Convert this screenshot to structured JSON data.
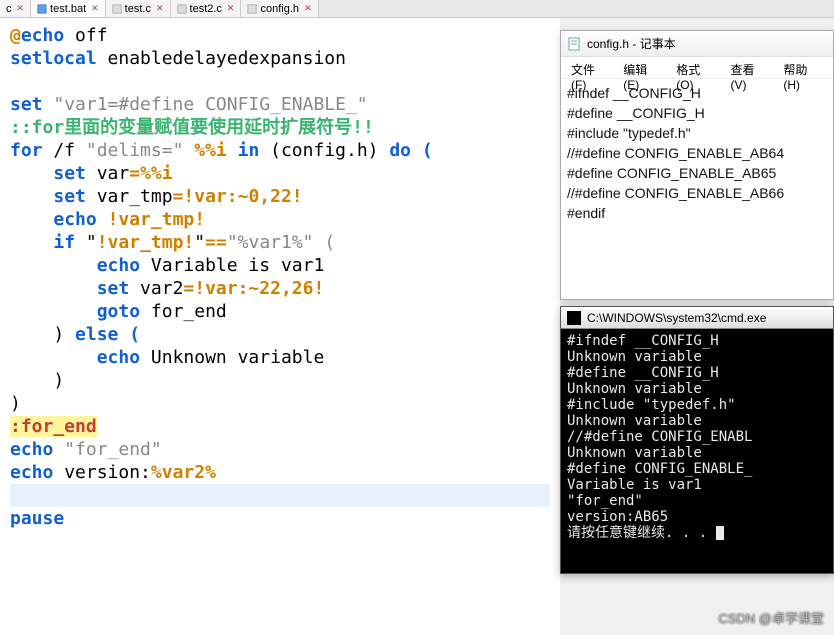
{
  "tabs": [
    {
      "label": "c",
      "active": false
    },
    {
      "label": "test.bat",
      "active": true
    },
    {
      "label": "test.c",
      "active": false
    },
    {
      "label": "test2.c",
      "active": false
    },
    {
      "label": "config.h",
      "active": false
    }
  ],
  "code": {
    "l1a": "@",
    "l1b": "echo",
    "l1c": " off",
    "l2a": "setlocal",
    "l2b": " enabledelayedexpansion",
    "l4a": "set",
    "l4b": " \"var1=#define CONFIG_ENABLE_\"",
    "l5": "::for里面的变量赋值要使用延时扩展符号!!",
    "l6a": "for",
    "l6b": " /f ",
    "l6c": "\"delims=\"",
    "l6d": " %%i ",
    "l6e": "in",
    "l6f": " (config.h) ",
    "l6g": "do (",
    "l7a": "    ",
    "l7b": "set",
    "l7c": " var",
    "l7d": "=",
    "l7e": "%%i",
    "l8a": "    ",
    "l8b": "set",
    "l8c": " var_tmp",
    "l8d": "=",
    "l8e": "!var:~0,22!",
    "l9a": "    ",
    "l9b": "echo",
    "l9c": " ",
    "l9d": "!var_tmp!",
    "l10a": "    ",
    "l10b": "if",
    "l10c": " \"",
    "l10d": "!var_tmp!",
    "l10e": "\"",
    "l10f": "==",
    "l10g": "\"%var1%\" (",
    "l11a": "        ",
    "l11b": "echo",
    "l11c": " Variable is var1",
    "l12a": "        ",
    "l12b": "set",
    "l12c": " var2",
    "l12d": "=",
    "l12e": "!var:~22,26!",
    "l13a": "        ",
    "l13b": "goto",
    "l13c": " for_end",
    "l14a": "    ) ",
    "l14b": "else (",
    "l15a": "        ",
    "l15b": "echo",
    "l15c": " Unknown variable",
    "l16": "    )",
    "l17": ")",
    "l18": ":for_end",
    "l19a": "echo",
    "l19b": " \"for_end\"",
    "l20a": "echo",
    "l20b": " version:",
    "l20c": "%var2%",
    "l22": "pause"
  },
  "notepad": {
    "title": "config.h - 记事本",
    "menu": {
      "file": "文件(F)",
      "edit": "编辑(E)",
      "fmt": "格式(O)",
      "view": "查看(V)",
      "help": "帮助(H)"
    },
    "lines": [
      "#ifndef __CONFIG_H",
      "#define __CONFIG_H",
      "",
      "#include \"typedef.h\"",
      "",
      "//#define CONFIG_ENABLE_AB64",
      "#define CONFIG_ENABLE_AB65",
      "//#define CONFIG_ENABLE_AB66",
      "",
      "#endif"
    ]
  },
  "cmd": {
    "title": "C:\\WINDOWS\\system32\\cmd.exe",
    "lines": [
      "#ifndef __CONFIG_H",
      "Unknown variable",
      "#define __CONFIG_H",
      "Unknown variable",
      "#include \"typedef.h\"",
      "Unknown variable",
      "//#define CONFIG_ENABL",
      "Unknown variable",
      "#define CONFIG_ENABLE_",
      "Variable is var1",
      "\"for_end\"",
      "version:AB65",
      "请按任意键继续. . . "
    ]
  },
  "watermark": "CSDN @卓学课堂"
}
